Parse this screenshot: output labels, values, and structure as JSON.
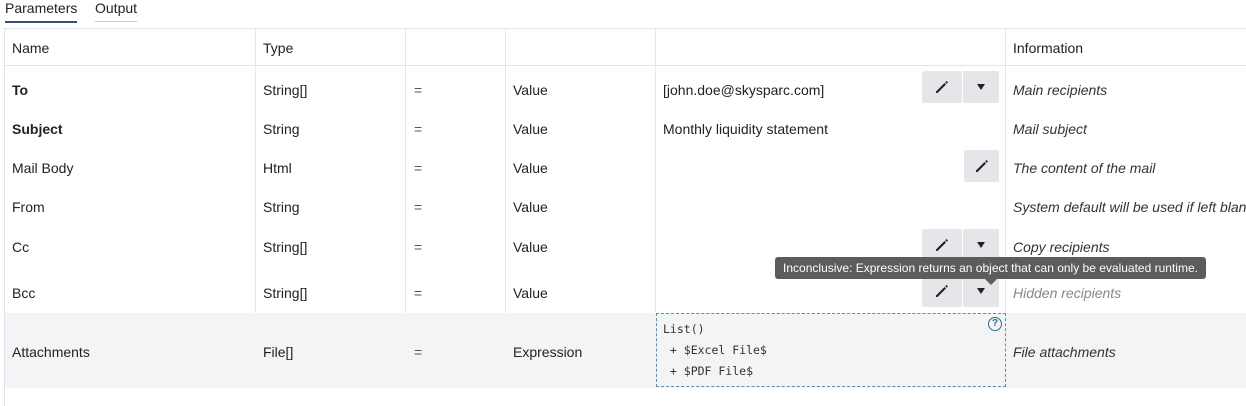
{
  "tabs": [
    {
      "label": "Parameters",
      "active": true
    },
    {
      "label": "Output",
      "active": false
    }
  ],
  "columns": {
    "name": "Name",
    "type": "Type",
    "operator": "",
    "mode": "",
    "value": "",
    "information": "Information"
  },
  "rows": [
    {
      "name": "To",
      "bold": true,
      "type": "String[]",
      "operator": "=",
      "mode": "Value",
      "value": "[john.doe@skysparc.com]",
      "information": "Main recipients",
      "buttons": [
        "edit-button",
        "dropdown-button"
      ]
    },
    {
      "name": "Subject",
      "bold": true,
      "type": "String",
      "operator": "=",
      "mode": "Value",
      "value": "Monthly liquidity statement",
      "information": "Mail subject",
      "buttons": []
    },
    {
      "name": "Mail Body",
      "bold": false,
      "type": "Html",
      "operator": "=",
      "mode": "Value",
      "value": "",
      "information": "The content of the mail",
      "buttons": [
        "edit-button"
      ]
    },
    {
      "name": "From",
      "bold": false,
      "type": "String",
      "operator": "=",
      "mode": "Value",
      "value": "",
      "information": "System default will be used if left blank",
      "buttons": []
    },
    {
      "name": "Cc",
      "bold": false,
      "type": "String[]",
      "operator": "=",
      "mode": "Value",
      "value": "",
      "information": "Copy recipients",
      "buttons": [
        "edit-button",
        "dropdown-button"
      ]
    },
    {
      "name": "Bcc",
      "bold": false,
      "type": "String[]",
      "operator": "=",
      "mode": "Value",
      "value": "",
      "information": "Hidden recipients",
      "buttons": [
        "edit-button",
        "dropdown-button"
      ]
    },
    {
      "name": "Attachments",
      "bold": false,
      "type": "File[]",
      "operator": "=",
      "mode": "Expression",
      "information": "File attachments",
      "expression_lines": [
        "List()",
        " + $Excel File$",
        " + $PDF File$"
      ]
    }
  ],
  "tooltip": {
    "text": "Inconclusive: Expression returns an object that can only be evaluated runtime."
  },
  "icons": {
    "edit": "pencil-icon",
    "dropdown": "caret-down-icon",
    "help": "question-circle-icon"
  },
  "colors": {
    "active_tab_underline": "#3a4a7a",
    "tooltip_bg": "#5c5c5c",
    "help_icon": "#2a6f8a",
    "expr_border": "#5a8fb0"
  }
}
